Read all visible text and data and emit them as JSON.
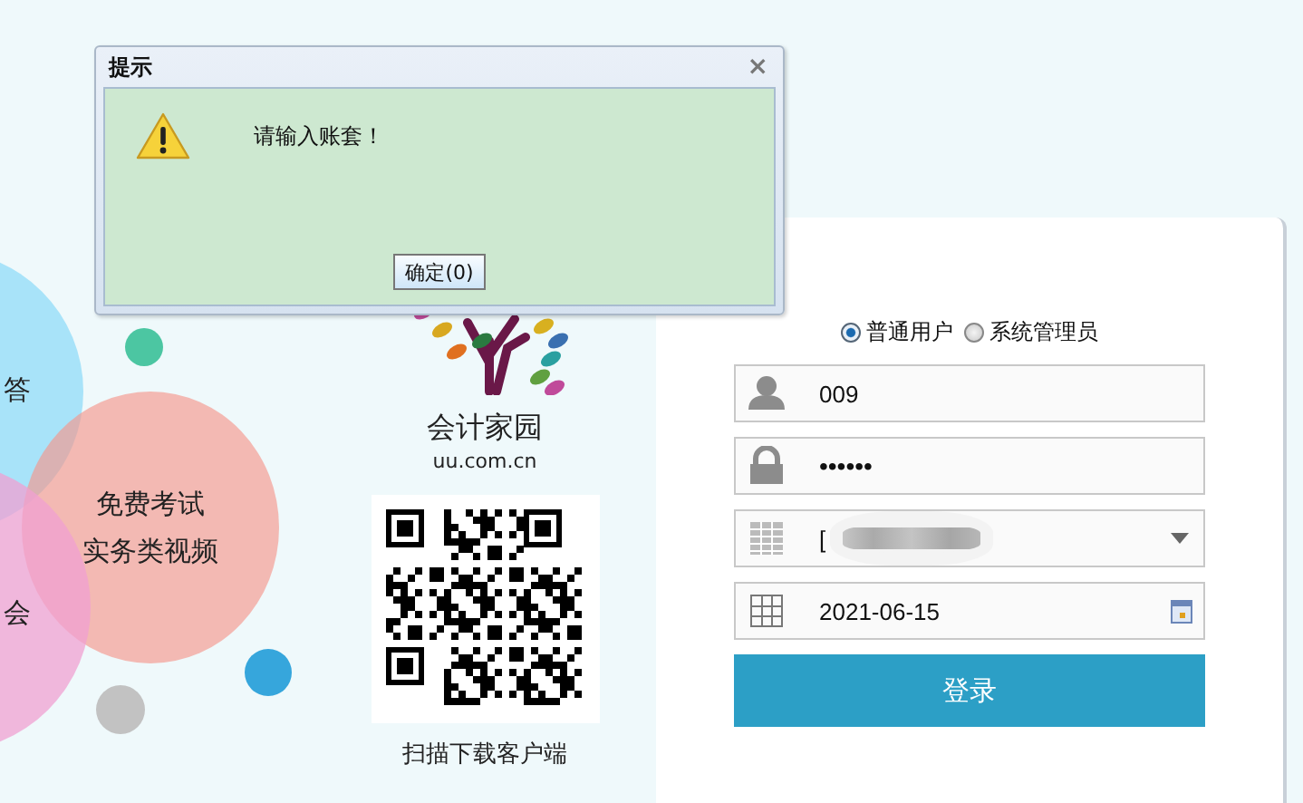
{
  "dialog": {
    "title": "提示",
    "close": "×",
    "message": "请输入账套！",
    "button": "确定(0)"
  },
  "bubbles": [
    {
      "lines": [
        "答"
      ]
    },
    {
      "lines": [
        "免费考试",
        "实务类视频"
      ]
    },
    {
      "lines": [
        "会"
      ]
    }
  ],
  "brand": {
    "name": "会计家园",
    "url": "uu.com.cn",
    "qr_caption": "扫描下载客户端"
  },
  "login": {
    "roles": [
      {
        "label": "普通用户",
        "selected": true
      },
      {
        "label": "系统管理员",
        "selected": false
      }
    ],
    "fields": [
      {
        "kind": "user",
        "value": "009"
      },
      {
        "kind": "password",
        "value": "••••••"
      },
      {
        "kind": "select",
        "value": "["
      },
      {
        "kind": "date",
        "value": "2021-06-15"
      }
    ],
    "submit": "登录"
  }
}
